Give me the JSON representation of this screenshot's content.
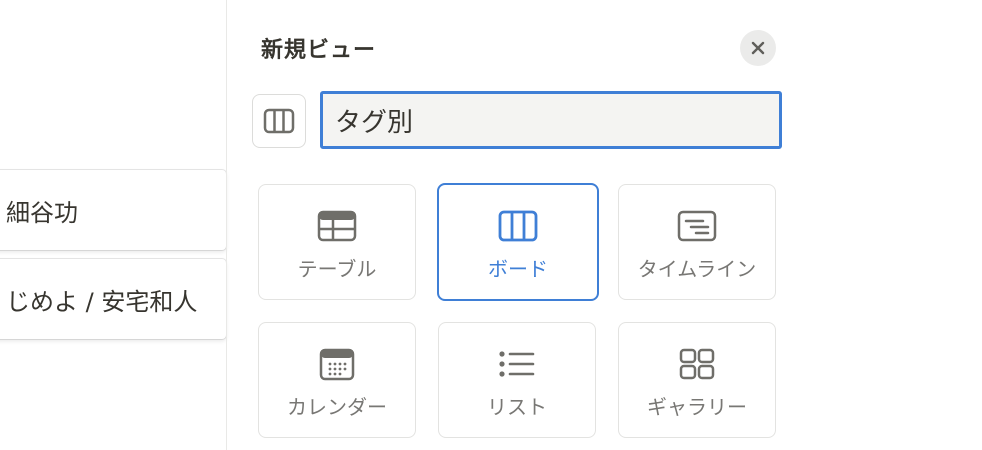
{
  "board": {
    "cards": [
      {
        "text": "細谷功"
      },
      {
        "text": "じめよ / 安宅和人"
      }
    ]
  },
  "panel": {
    "title": "新規ビュー",
    "name_value": "タグ別",
    "icons": {
      "close": "close-icon",
      "current_layout": "board-layout-icon"
    },
    "layouts": [
      {
        "label": "テーブル",
        "icon": "table-icon",
        "selected": false
      },
      {
        "label": "ボード",
        "icon": "board-icon",
        "selected": true
      },
      {
        "label": "タイムライン",
        "icon": "timeline-icon",
        "selected": false
      },
      {
        "label": "カレンダー",
        "icon": "calendar-icon",
        "selected": false
      },
      {
        "label": "リスト",
        "icon": "list-icon",
        "selected": false
      },
      {
        "label": "ギャラリー",
        "icon": "gallery-icon",
        "selected": false
      }
    ]
  },
  "colors": {
    "accent": "#3f7fd6",
    "icon_gray": "#6f6e69",
    "text": "#37352f"
  }
}
